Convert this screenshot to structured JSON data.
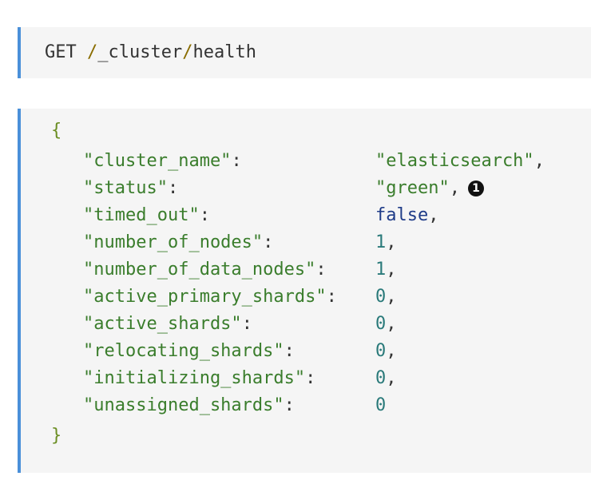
{
  "request": {
    "method": "GET",
    "slash1": "/",
    "segment1": "_cluster",
    "slash2": "/",
    "segment2": "health"
  },
  "response": {
    "open_brace": "{",
    "close_brace": "}",
    "rows": [
      {
        "key": "\"cluster_name\"",
        "value": "\"elasticsearch\"",
        "trail": ","
      },
      {
        "key": "\"status\"",
        "value": "\"green\"",
        "trail": ","
      },
      {
        "key": "\"timed_out\"",
        "value": "false",
        "trail": ","
      },
      {
        "key": "\"number_of_nodes\"",
        "value": "1",
        "trail": ","
      },
      {
        "key": "\"number_of_data_nodes\"",
        "value": "1",
        "trail": ","
      },
      {
        "key": "\"active_primary_shards\"",
        "value": "0",
        "trail": ","
      },
      {
        "key": "\"active_shards\"",
        "value": "0",
        "trail": ","
      },
      {
        "key": "\"relocating_shards\"",
        "value": "0",
        "trail": ","
      },
      {
        "key": "\"initializing_shards\"",
        "value": "0",
        "trail": ","
      },
      {
        "key": "\"unassigned_shards\"",
        "value": "0",
        "trail": ""
      }
    ],
    "callout_label": "1"
  },
  "colors": {
    "accent_border": "#4a90d9",
    "code_background": "#f5f5f5",
    "string_green": "#3a7d2c",
    "keyword_navy": "#1f3c88",
    "number_teal": "#2a7a7a"
  }
}
